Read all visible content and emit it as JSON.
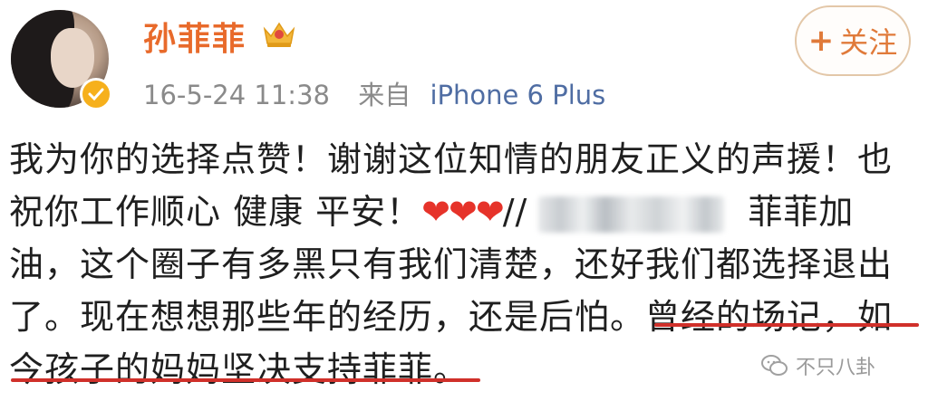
{
  "post": {
    "username": "孙菲菲",
    "timestamp": "16-5-24 11:38",
    "source_prefix": "来自",
    "device": "iPhone 6 Plus",
    "follow_plus": "+",
    "follow_label": "关注",
    "lines": {
      "l1": "我为你的选择点赞！谢谢这位知情的朋友正义的声援！也",
      "l2_prefix": "祝你工作顺心 健康 平安！",
      "l2_hearts": "❤❤❤",
      "l2_slashes": "//",
      "l2_suffix": "菲菲加",
      "l3": "油，这个圈子有多黑只有我们清楚，还好我们都选择退出",
      "l4": "了。现在想想那些年的经历，还是后怕。曾经的场记，如",
      "l5": "今孩子的妈妈坚决支持菲菲。"
    }
  },
  "watermark": {
    "label": "不只八卦"
  },
  "colors": {
    "username": "#e86a2b",
    "device_link": "#4f6da3",
    "underline": "#d0302a",
    "heart": "#e6332a"
  },
  "icons": [
    "avatar",
    "verified-badge-icon",
    "crown-icon",
    "heart-icon",
    "wechat-icon"
  ]
}
